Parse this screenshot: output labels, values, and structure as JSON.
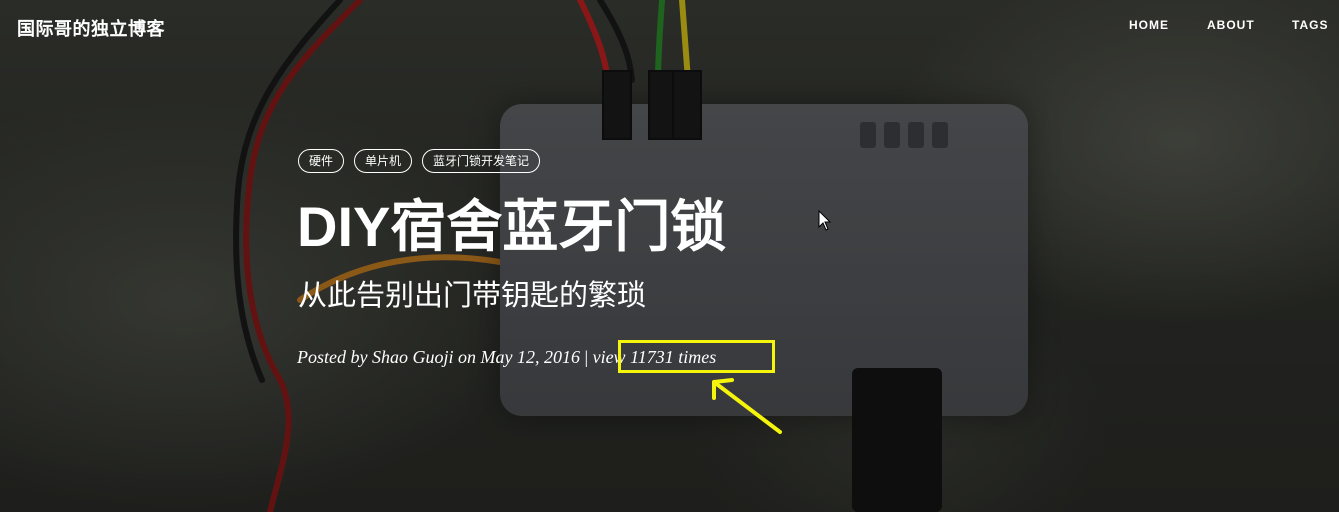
{
  "site": {
    "brand": "国际哥的独立博客"
  },
  "nav": {
    "items": [
      {
        "label": "HOME"
      },
      {
        "label": "ABOUT"
      },
      {
        "label": "TAGS"
      }
    ]
  },
  "post": {
    "tags": [
      "硬件",
      "单片机",
      "蓝牙门锁开发笔记"
    ],
    "title": "DIY宿舍蓝牙门锁",
    "subtitle": "从此告别出门带钥匙的繁琐",
    "meta": {
      "posted_text": "Posted by Shao Guoji on May 12, 2016",
      "separator": "|",
      "views_text": "view 11731 times"
    }
  },
  "annotation": {
    "highlight_color": "#f5f50c"
  }
}
